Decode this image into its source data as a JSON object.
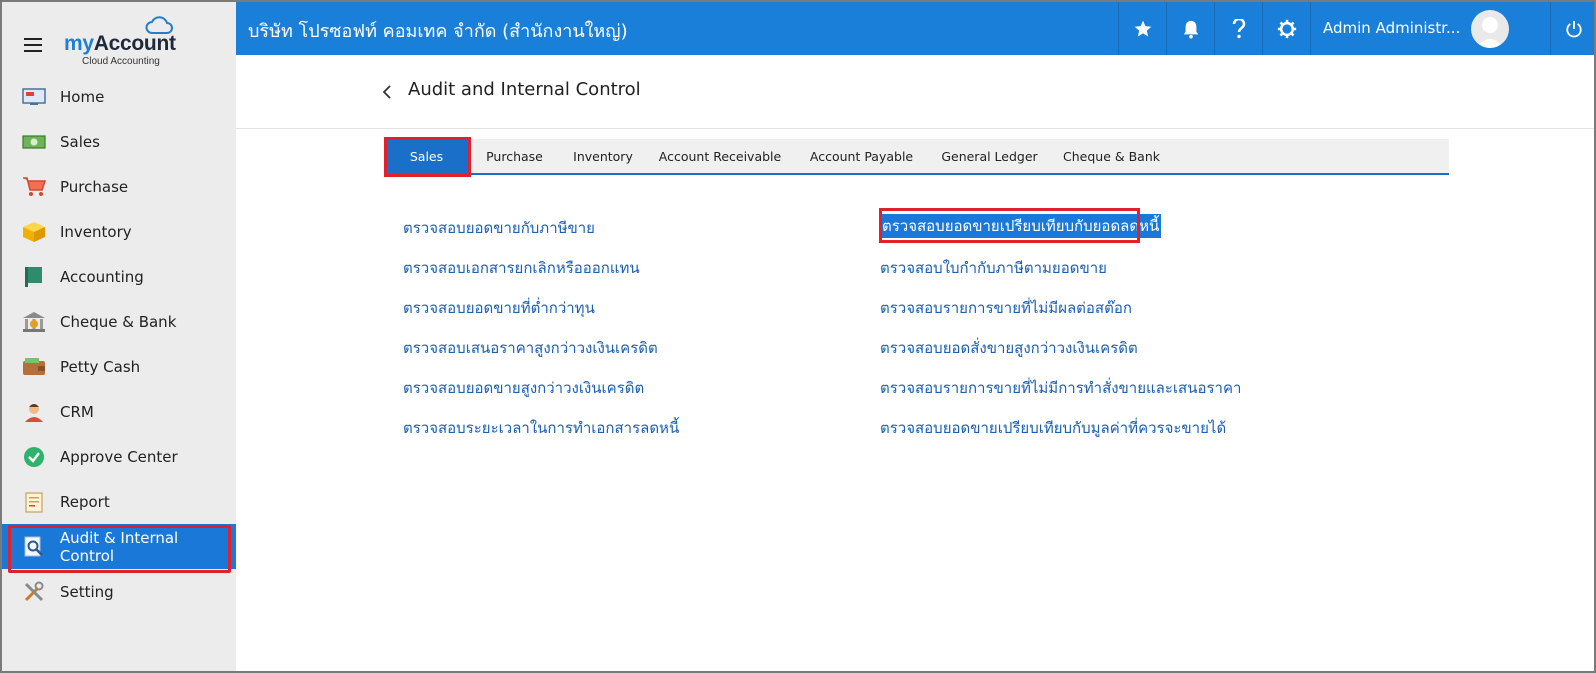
{
  "brand": {
    "name_prefix": "my",
    "name_suffix": "Account",
    "tagline": "Cloud Accounting"
  },
  "sidebar": {
    "items": [
      {
        "label": "Home",
        "icon": "home-monitor-icon"
      },
      {
        "label": "Sales",
        "icon": "cash-icon"
      },
      {
        "label": "Purchase",
        "icon": "shopping-cart-icon"
      },
      {
        "label": "Inventory",
        "icon": "box-icon"
      },
      {
        "label": "Accounting",
        "icon": "ledger-book-icon"
      },
      {
        "label": "Cheque & Bank",
        "icon": "bank-icon"
      },
      {
        "label": "Petty Cash",
        "icon": "wallet-icon"
      },
      {
        "label": "CRM",
        "icon": "person-icon"
      },
      {
        "label": "Approve Center",
        "icon": "check-circle-icon"
      },
      {
        "label": "Report",
        "icon": "report-icon"
      },
      {
        "label": "Audit & Internal Control",
        "icon": "audit-magnifier-icon",
        "active": true
      },
      {
        "label": "Setting",
        "icon": "tools-icon"
      }
    ]
  },
  "topbar": {
    "company": "บริษัท โปรซอฟท์ คอมเทค จำกัด (สำนักงานใหญ่)",
    "user_name": "Admin Administr...",
    "icons": [
      "star-icon",
      "bell-icon",
      "help-icon",
      "gear-icon",
      "power-icon"
    ]
  },
  "page": {
    "title": "Audit and Internal Control"
  },
  "tabs": [
    {
      "label": "Sales",
      "active": true
    },
    {
      "label": "Purchase"
    },
    {
      "label": "Inventory"
    },
    {
      "label": "Account Receivable"
    },
    {
      "label": "Account Payable"
    },
    {
      "label": "General Ledger"
    },
    {
      "label": "Cheque & Bank"
    }
  ],
  "links": {
    "left": [
      "ตรวจสอบยอดขายกับภาษีขาย",
      "ตรวจสอบเอกสารยกเลิกหรือออกแทน",
      "ตรวจสอบยอดขายที่ต่ำกว่าทุน",
      "ตรวจสอบเสนอราคาสูงกว่าวงเงินเครดิต",
      "ตรวจสอบยอดขายสูงกว่าวงเงินเครดิต",
      "ตรวจสอบระยะเวลาในการทำเอกสารลดหนี้"
    ],
    "right": [
      "ตรวจสอบยอดขายเปรียบเทียบกับยอดลดหนี้",
      "ตรวจสอบใบกำกับภาษีตามยอดขาย",
      "ตรวจสอบรายการขายที่ไม่มีผลต่อสต๊อก",
      "ตรวจสอบยอดสั่งขายสูงกว่าวงเงินเครดิต",
      "ตรวจสอบรายการขายที่ไม่มีการทำสั่งขายและเสนอราคา",
      "ตรวจสอบยอดขายเปรียบเทียบกับมูลค่าที่ควรจะขายได้"
    ]
  },
  "colors": {
    "primary": "#1a7fd8",
    "highlight": "#e0202a",
    "link": "#1a5fb4",
    "sidebar_bg": "#ececec"
  }
}
